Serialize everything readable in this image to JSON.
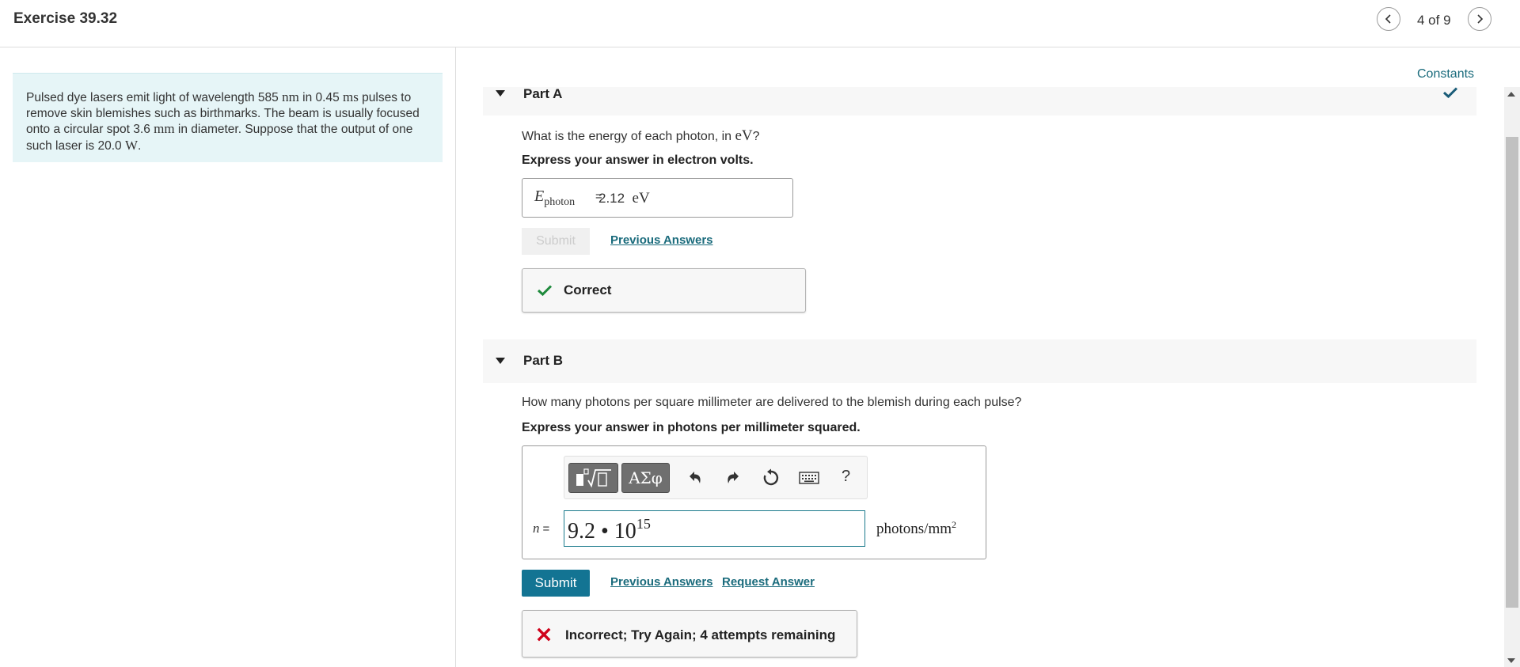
{
  "header": {
    "title": "Exercise 39.32",
    "page_indicator": "4 of 9"
  },
  "problem": {
    "text_1": "Pulsed dye lasers emit light of wavelength 585 ",
    "unit_nm": "nm",
    "text_2": " in 0.45 ",
    "unit_ms": "ms",
    "text_3": " pulses to remove skin blemishes such as birthmarks. The beam is usually focused onto a circular spot 3.6 ",
    "unit_mm": "mm",
    "text_4": " in diameter. Suppose that the output of one such laser is 20.0 ",
    "unit_w": "W",
    "text_5": "."
  },
  "constants_link": "Constants",
  "colors": {
    "accent": "#137493",
    "link": "#1a6b7c",
    "correct_green": "#1e8a3c",
    "incorrect_red": "#d0021b",
    "problem_bg": "#e6f5f7"
  },
  "part_a": {
    "label": "Part A",
    "question_text": "What is the energy of each photon, in ",
    "question_unit": "eV",
    "question_end": "?",
    "instruction": "Express your answer in electron volts.",
    "answer_var": "E",
    "answer_sub": "photon",
    "answer_eq": "=",
    "answer_value": "2.12",
    "answer_unit": "eV",
    "submit_label": "Submit",
    "previous_answers_label": "Previous Answers",
    "feedback": "Correct"
  },
  "part_b": {
    "label": "Part B",
    "question": "How many photons per square millimeter are delivered to the blemish during each pulse?",
    "instruction": "Express your answer in photons per millimeter squared.",
    "toolbar": {
      "symbols_label": "ΑΣφ",
      "help_label": "?",
      "icons": [
        "templates-icon",
        "symbols-icon",
        "undo-icon",
        "redo-icon",
        "reset-icon",
        "keyboard-icon",
        "help-icon"
      ]
    },
    "answer_var": "n",
    "answer_eq": "=",
    "answer_mantissa": "9.2 • 10",
    "answer_exponent": "15",
    "units_main": "photons/mm",
    "units_exp": "2",
    "submit_label": "Submit",
    "previous_answers_label": "Previous Answers",
    "request_answer_label": "Request Answer",
    "feedback": "Incorrect; Try Again; 4 attempts remaining"
  }
}
